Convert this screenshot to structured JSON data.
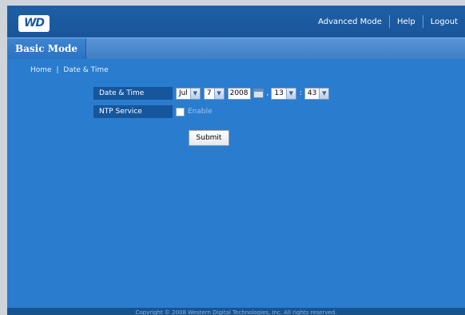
{
  "header": {
    "logo_text": "WD",
    "nav": [
      "Advanced Mode",
      "Help",
      "Logout"
    ]
  },
  "mode": {
    "title": "Basic Mode"
  },
  "breadcrumb": {
    "home": "Home",
    "separator": "|",
    "current": "Date & Time"
  },
  "form": {
    "date_time_label": "Date & Time",
    "month": "Jul",
    "day": "7",
    "year": "2008",
    "hour": "13",
    "minute": "43",
    "time_separator": ":",
    "ntp_label": "NTP Service",
    "ntp_enable_label": "Enable",
    "ntp_enabled": false,
    "submit_label": "Submit"
  },
  "footer": {
    "text": "Copyright © 2008 Western Digital Technologies, Inc. All rights reserved."
  },
  "colors": {
    "background": "#2a7ccf",
    "topbar": "#1a559a",
    "label_cell": "#16569c"
  }
}
